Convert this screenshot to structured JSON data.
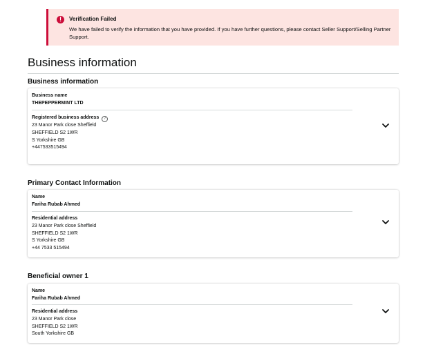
{
  "alert": {
    "icon": "exclamation-icon",
    "title": "Verification Failed",
    "message": "We have failed to verify the information that you have provided. If you have further questions, please contact Seller Support/Selling Partner Support.",
    "color": "#cc0c39",
    "background": "#fde4e1"
  },
  "page_title": "Business information",
  "sections": {
    "business": {
      "heading": "Business information",
      "name_label": "Business name",
      "name_value": "THEPEPPERMINT LTD",
      "address_label": "Registered business address",
      "address_lines": [
        "23 Manor Park close Sheffield",
        "SHEFFIELD S2 1WR",
        "S Yorkshire GB",
        "+447533515494"
      ]
    },
    "primary_contact": {
      "heading": "Primary Contact Information",
      "name_label": "Name",
      "name_value": "Fariha Rubab Ahmed",
      "address_label": "Residential address",
      "address_lines": [
        "23 Manor Park close Sheffield",
        "SHEFFIELD S2 1WR",
        "S Yorkshire GB",
        "+44 7533 515494"
      ]
    },
    "beneficial_owner": {
      "heading": "Beneficial owner 1",
      "name_label": "Name",
      "name_value": "Fariha Rubab Ahmed",
      "address_label": "Residential address",
      "address_lines": [
        "23 Manor Park close",
        "SHEFFIELD S2 1WR",
        "South Yorkshire GB"
      ]
    }
  },
  "icons": {
    "help": "question-circle-icon",
    "expand": "chevron-down-icon"
  }
}
